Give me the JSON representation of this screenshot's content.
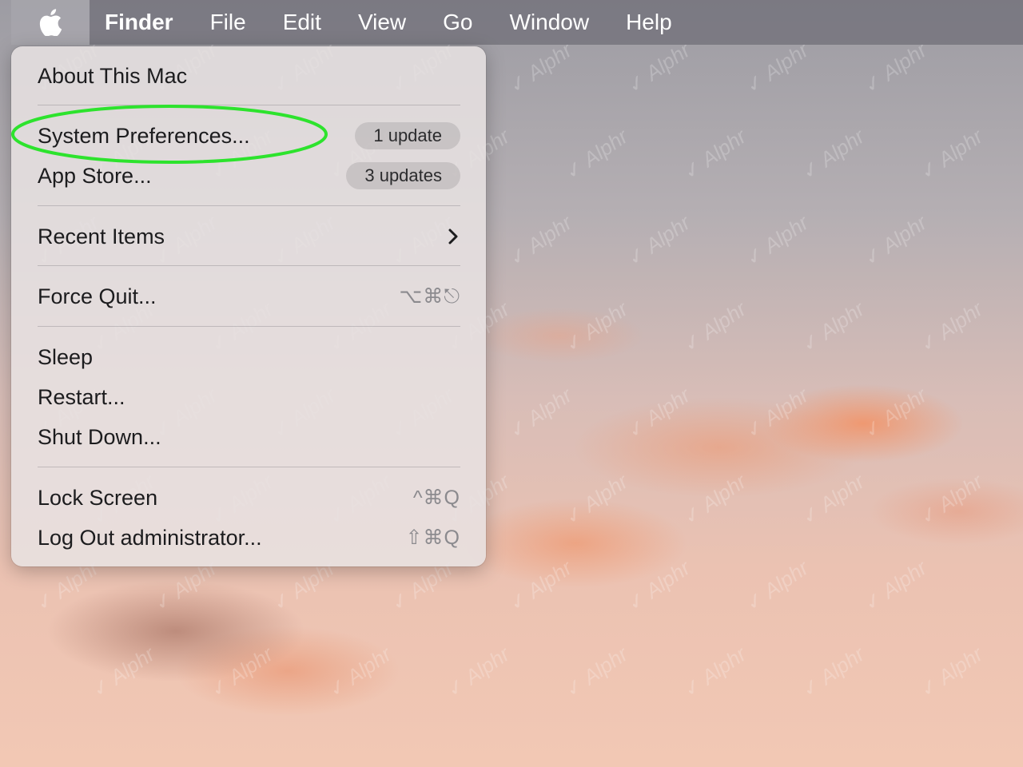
{
  "menubar": {
    "apple_icon": "apple-logo-icon",
    "items": [
      {
        "label": "Finder"
      },
      {
        "label": "File"
      },
      {
        "label": "Edit"
      },
      {
        "label": "View"
      },
      {
        "label": "Go"
      },
      {
        "label": "Window"
      },
      {
        "label": "Help"
      }
    ]
  },
  "apple_menu": {
    "about": "About This Mac",
    "system_preferences": {
      "label": "System Preferences...",
      "badge": "1 update"
    },
    "app_store": {
      "label": "App Store...",
      "badge": "3 updates"
    },
    "recent_items": {
      "label": "Recent Items",
      "icon": "chevron-right-icon"
    },
    "force_quit": {
      "label": "Force Quit...",
      "shortcut": "⌥⌘⎋"
    },
    "sleep": "Sleep",
    "restart": "Restart...",
    "shut_down": "Shut Down...",
    "lock_screen": {
      "label": "Lock Screen",
      "shortcut": "^⌘Q"
    },
    "log_out": {
      "label": "Log Out administrator...",
      "shortcut": "⇧⌘Q"
    }
  },
  "annotation": {
    "highlight_color": "#2de32d",
    "target": "System Preferences..."
  },
  "watermark": "Alphr",
  "colors": {
    "menu_text": "#1c1c1e",
    "shortcut_text": "#8b8a8e",
    "menubar_text": "#ffffff"
  }
}
